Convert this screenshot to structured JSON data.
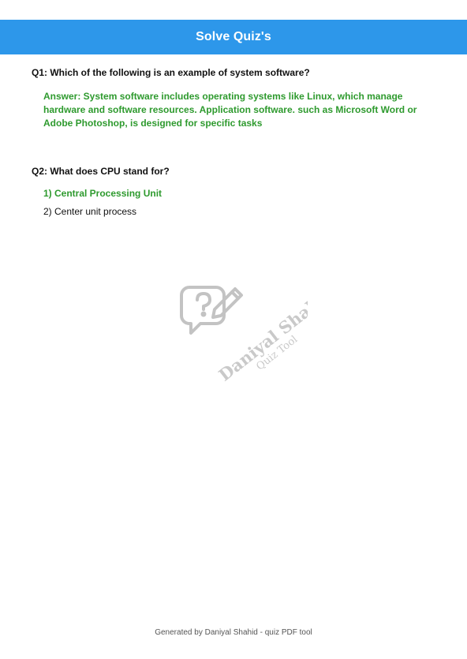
{
  "header": {
    "title": "Solve Quiz's",
    "background": "#2d97ea"
  },
  "questions": [
    {
      "text": "Q1: Which of the following is an example of system software?",
      "answer": "Answer: System software includes operating systems like Linux, which manage hardware and software resources. Application software. such as Microsoft Word or Adobe Photoshop, is designed for specific tasks"
    },
    {
      "text": "Q2: What does CPU stand for?",
      "options": [
        {
          "label": "1) Central Processing Unit",
          "correct": true
        },
        {
          "label": "2) Center unit process",
          "correct": false
        }
      ]
    }
  ],
  "watermark": {
    "line1": "Daniyal Shahid",
    "line2": "Quiz Tool",
    "icon": "question-bubble-pencil-icon"
  },
  "footer": {
    "text": "Generated by Daniyal Shahid - quiz PDF tool"
  },
  "colors": {
    "accent": "#2d97ea",
    "correct": "#2e9a2e",
    "text": "#111111"
  }
}
